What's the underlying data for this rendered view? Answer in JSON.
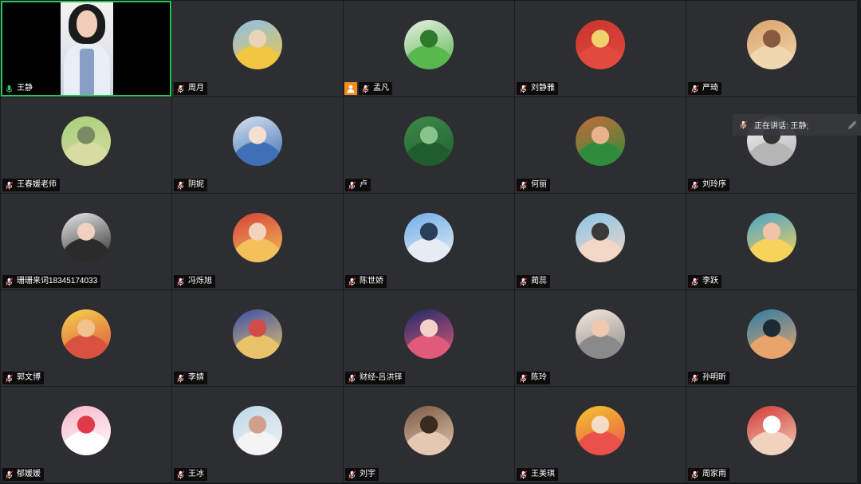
{
  "speaking_banner": {
    "text": "正在讲话: 王静;"
  },
  "participants": [
    {
      "name": "王静",
      "mic": "speaking-mic-icon",
      "avatar": "video",
      "colors": [
        "#000000"
      ]
    },
    {
      "name": "周月",
      "mic": "muted-mic-icon",
      "avatar": "child-yellow-hat",
      "colors": [
        "#8cc0ea",
        "#f2c640",
        "#e9d4b8"
      ]
    },
    {
      "name": "孟凡",
      "mic": "muted-mic-icon",
      "avatar": "green-leaf-character",
      "colors": [
        "#e8efe2",
        "#58b84e",
        "#2c7a2c"
      ]
    },
    {
      "name": "刘静雅",
      "mic": "muted-mic-icon",
      "avatar": "flag-photo",
      "colors": [
        "#c8342c",
        "#e24a3f",
        "#f0d26c"
      ]
    },
    {
      "name": "严琦",
      "mic": "muted-mic-icon",
      "avatar": "building-photo",
      "colors": [
        "#d9a46c",
        "#f1d7b0",
        "#8a5a3c"
      ]
    },
    {
      "name": "王春媛老师",
      "mic": "muted-mic-icon",
      "avatar": "road-landscape",
      "colors": [
        "#a7cf7a",
        "#d8dca0",
        "#7a8a63"
      ]
    },
    {
      "name": "阴妮",
      "mic": "muted-mic-icon",
      "avatar": "anime-boy",
      "colors": [
        "#d7e1ee",
        "#3f6fb6",
        "#f4e0d0"
      ]
    },
    {
      "name": "卢",
      "mic": "muted-mic-icon",
      "avatar": "green-leaves",
      "colors": [
        "#3f8a4b",
        "#1f5e2c",
        "#86c48b"
      ]
    },
    {
      "name": "何丽",
      "mic": "muted-mic-icon",
      "avatar": "woman-green-shirt",
      "colors": [
        "#c46a3c",
        "#2f8c3a",
        "#e8b28d"
      ]
    },
    {
      "name": "刘玲序",
      "mic": "muted-mic-icon",
      "avatar": "sketch",
      "colors": [
        "#f2f2f2",
        "#b5b5b5",
        "#333333"
      ]
    },
    {
      "name": "珊珊来词18345174033",
      "mic": "muted-mic-icon",
      "avatar": "woman-portrait",
      "colors": [
        "#e8e8ea",
        "#2b2b2b",
        "#f0d0c0"
      ]
    },
    {
      "name": "冯烁旭",
      "mic": "muted-mic-icon",
      "avatar": "child-festive",
      "colors": [
        "#d5403a",
        "#f4c05a",
        "#f2d2bc"
      ]
    },
    {
      "name": "陈世娇",
      "mic": "muted-mic-icon",
      "avatar": "castle",
      "colors": [
        "#6faee6",
        "#e7ecf4",
        "#2b3f5a"
      ]
    },
    {
      "name": "蔺蕊",
      "mic": "muted-mic-icon",
      "avatar": "child-drawing",
      "colors": [
        "#8ac4e8",
        "#f3d7c6",
        "#3a3a3a"
      ]
    },
    {
      "name": "李跃",
      "mic": "muted-mic-icon",
      "avatar": "alice-cartoon",
      "colors": [
        "#4aa3c9",
        "#f6d35a",
        "#f0c4a8"
      ]
    },
    {
      "name": "郭文博",
      "mic": "muted-mic-icon",
      "avatar": "cartoon-family",
      "colors": [
        "#f7d24d",
        "#d9523f",
        "#f1c28e"
      ]
    },
    {
      "name": "李婧",
      "mic": "muted-mic-icon",
      "avatar": "anime-hero",
      "colors": [
        "#3d4fa6",
        "#e8c36a",
        "#d24a4a"
      ]
    },
    {
      "name": "财经-吕洪铎",
      "mic": "muted-mic-icon",
      "avatar": "anime-girl",
      "colors": [
        "#1f2a66",
        "#e05a7a",
        "#f3d0c8"
      ]
    },
    {
      "name": "陈玲",
      "mic": "muted-mic-icon",
      "avatar": "cartoon-girl-hat",
      "colors": [
        "#f6e9dc",
        "#8a8a8a",
        "#f0c9b0"
      ]
    },
    {
      "name": "孙明昕",
      "mic": "muted-mic-icon",
      "avatar": "seaside-photo",
      "colors": [
        "#2f7ea6",
        "#e8a46a",
        "#1d2a33"
      ]
    },
    {
      "name": "郁媛媛",
      "mic": "muted-mic-icon",
      "avatar": "hello-kitty",
      "colors": [
        "#f7b6c8",
        "#ffffff",
        "#e03a4a"
      ]
    },
    {
      "name": "王冰",
      "mic": "muted-mic-icon",
      "avatar": "hand-cards",
      "colors": [
        "#bcd8e8",
        "#f4f4f4",
        "#d2a08a"
      ]
    },
    {
      "name": "刘宇",
      "mic": "muted-mic-icon",
      "avatar": "woman-photo",
      "colors": [
        "#7a5a44",
        "#e6c8b0",
        "#3a2a20"
      ]
    },
    {
      "name": "王美琪",
      "mic": "muted-mic-icon",
      "avatar": "cartoon-girl-yellow",
      "colors": [
        "#f3c62e",
        "#e9524a",
        "#f4dcc6"
      ]
    },
    {
      "name": "周家雨",
      "mic": "muted-mic-icon",
      "avatar": "child-red",
      "colors": [
        "#d33a36",
        "#f1d2bc",
        "#ffffff"
      ]
    }
  ]
}
